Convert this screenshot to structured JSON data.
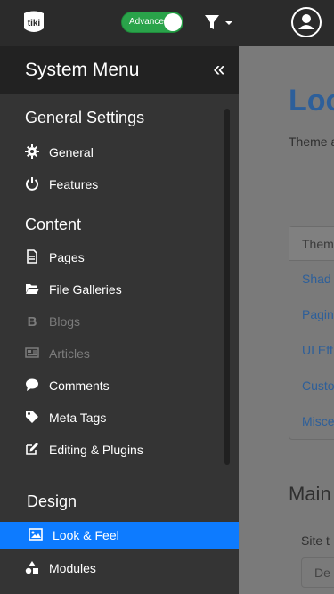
{
  "topbar": {
    "logo_text": "tiki",
    "mode_toggle_label": "Advanced",
    "filter_icon": "filter-icon",
    "user_icon": "user-icon"
  },
  "sidebar": {
    "title": "System Menu",
    "collapse_label": "«",
    "sections": [
      {
        "title": "General Settings",
        "items": [
          {
            "label": "General",
            "icon": "gear-icon",
            "disabled": false
          },
          {
            "label": "Features",
            "icon": "power-icon",
            "disabled": false
          }
        ]
      },
      {
        "title": "Content",
        "items": [
          {
            "label": "Pages",
            "icon": "file-icon",
            "disabled": false
          },
          {
            "label": "File Galleries",
            "icon": "folder-icon",
            "disabled": false
          },
          {
            "label": "Blogs",
            "icon": "bold-b-icon",
            "disabled": true
          },
          {
            "label": "Articles",
            "icon": "newspaper-icon",
            "disabled": true
          },
          {
            "label": "Comments",
            "icon": "comment-icon",
            "disabled": false
          },
          {
            "label": "Meta Tags",
            "icon": "tag-icon",
            "disabled": false
          },
          {
            "label": "Editing & Plugins",
            "icon": "edit-icon",
            "disabled": false
          }
        ]
      },
      {
        "title": "Design",
        "items": [
          {
            "label": "Look & Feel",
            "icon": "image-icon",
            "active": true
          },
          {
            "label": "Modules",
            "icon": "shapes-icon",
            "disabled": false
          }
        ]
      }
    ]
  },
  "background_page": {
    "title": "Loo",
    "description": "Theme and UI e",
    "card_header": "Them",
    "card_links": [
      "Shad",
      "Pagin",
      "UI Eff",
      "Custo",
      "Misce"
    ],
    "main_heading": "Main",
    "site_label": "Site t",
    "input_value": "De"
  },
  "colors": {
    "accent": "#0d7bff",
    "topbar_bg": "#2b2b2b",
    "sidebar_bg": "#343434",
    "toggle_on": "#2aa34a"
  }
}
